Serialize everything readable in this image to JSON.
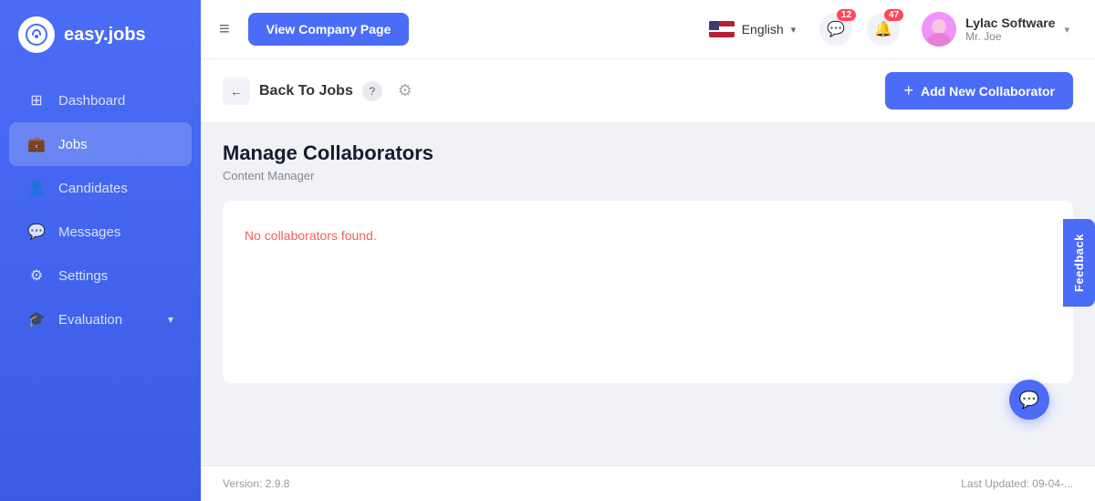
{
  "sidebar": {
    "logo_icon": "©",
    "logo_text": "easy.jobs",
    "nav_items": [
      {
        "id": "dashboard",
        "label": "Dashboard",
        "icon": "⊞",
        "active": false
      },
      {
        "id": "jobs",
        "label": "Jobs",
        "icon": "💼",
        "active": true
      },
      {
        "id": "candidates",
        "label": "Candidates",
        "icon": "👤",
        "active": false
      },
      {
        "id": "messages",
        "label": "Messages",
        "icon": "💬",
        "active": false
      },
      {
        "id": "settings",
        "label": "Settings",
        "icon": "⚙",
        "active": false
      },
      {
        "id": "evaluation",
        "label": "Evaluation",
        "icon": "🎓",
        "active": false,
        "has_chevron": true
      }
    ]
  },
  "header": {
    "view_company_label": "View Company Page",
    "language": "English",
    "notifications_count": "12",
    "alerts_count": "47",
    "user_name": "Lylac Software",
    "user_role": "Mr. Joe"
  },
  "page": {
    "back_label": "Back To Jobs",
    "add_collaborator_label": "Add New Collaborator",
    "title": "Manage Collaborators",
    "subtitle": "Content Manager",
    "no_results": "No collaborators found.",
    "feedback_label": "Feedback",
    "version": "Version: 2.9.8",
    "last_updated": "Last Updated: 09-04-..."
  }
}
